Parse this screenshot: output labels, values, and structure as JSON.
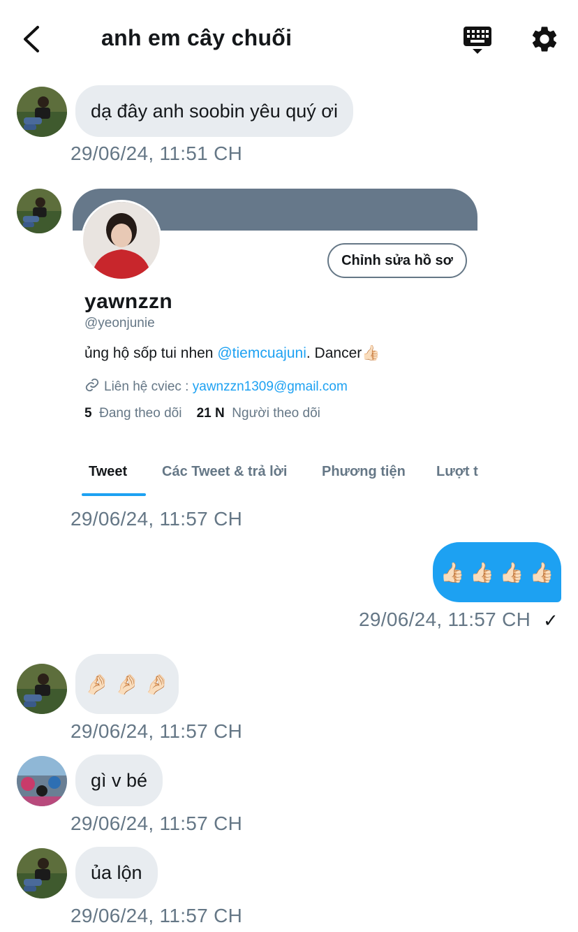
{
  "header": {
    "title": "anh em cây chuối",
    "icons": [
      "back-icon",
      "keyboard-icon",
      "gear-icon"
    ]
  },
  "messages": [
    {
      "text": "dạ đây anh soobin yêu quý ơi",
      "time": "29/06/24, 11:51 CH"
    },
    {
      "time": "29/06/24, 11:57 CH"
    },
    {
      "text": "👍🏻 👍🏻 👍🏻 👍🏻",
      "time": "29/06/24, 11:57 CH"
    },
    {
      "text": "🤌🏻 🤌🏻 🤌🏻",
      "time": "29/06/24, 11:57 CH"
    },
    {
      "text": "gì v bé",
      "time": "29/06/24, 11:57 CH"
    },
    {
      "text": "ủa lộn",
      "time": "29/06/24, 11:57 CH"
    }
  ],
  "profile_card": {
    "edit_button": "Chỉnh sửa hồ sơ",
    "name": "yawnzzn",
    "handle": "@yeonjunie",
    "bio_prefix": "ủng hộ sốp tui nhen ",
    "bio_mention": "@tiemcuajuni",
    "bio_suffix": ". Dancer👍🏻",
    "link_label": "Liên hệ cviec : ",
    "link_email": "yawnzzn1309@gmail.com",
    "following_count": "5",
    "following_label": "Đang theo dõi",
    "followers_count": "21 N",
    "followers_label": "Người theo dõi",
    "tabs": [
      "Tweet",
      "Các Tweet & trả lời",
      "Phương tiện",
      "Lượt t"
    ]
  },
  "colors": {
    "accent": "#1da1f2",
    "bubble_in": "#e8ecf0",
    "muted": "#657786",
    "banner": "#66788a"
  }
}
